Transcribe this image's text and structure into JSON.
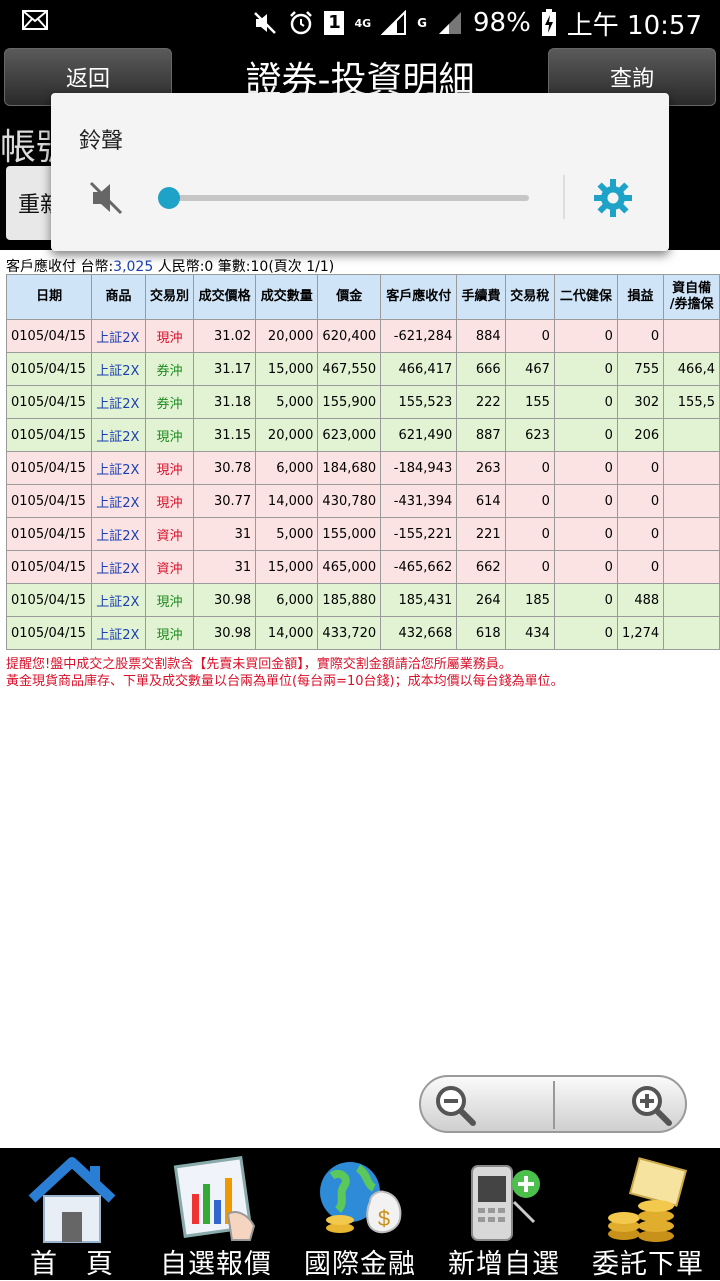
{
  "status_bar": {
    "battery": "98%",
    "time": "上午 10:57",
    "sim": "1",
    "network_4g": "4G",
    "network_g": "G"
  },
  "header": {
    "back_label": "返回",
    "title": "證券-投資明細",
    "query_label": "查詢"
  },
  "subarea": {
    "account_label": "帳號",
    "refresh_label": "重新"
  },
  "volume_popup": {
    "title": "鈴聲",
    "level": 0
  },
  "summary": {
    "prefix": "客戶應收付 台幣:",
    "twd_value": "3,025",
    "rest": " 人民幣:0 筆數:10(頁次 1/1)"
  },
  "table": {
    "headers": [
      "日期",
      "商品",
      "交易別",
      "成交價格",
      "成交數量",
      "價金",
      "客戶應收付",
      "手續費",
      "交易稅",
      "二代健保",
      "損益",
      "資自備\n/券擔保"
    ],
    "rows": [
      {
        "style": "pink",
        "cells": [
          "0105/04/15",
          "上証2X",
          "現沖",
          "31.02",
          "20,000",
          "620,400",
          "-621,284",
          "884",
          "0",
          "0",
          "0",
          ""
        ],
        "type_color": "red"
      },
      {
        "style": "green",
        "cells": [
          "0105/04/15",
          "上証2X",
          "券沖",
          "31.17",
          "15,000",
          "467,550",
          "466,417",
          "666",
          "467",
          "0",
          "755",
          "466,4"
        ],
        "type_color": "green"
      },
      {
        "style": "green",
        "cells": [
          "0105/04/15",
          "上証2X",
          "券沖",
          "31.18",
          "5,000",
          "155,900",
          "155,523",
          "222",
          "155",
          "0",
          "302",
          "155,5"
        ],
        "type_color": "green"
      },
      {
        "style": "green",
        "cells": [
          "0105/04/15",
          "上証2X",
          "現沖",
          "31.15",
          "20,000",
          "623,000",
          "621,490",
          "887",
          "623",
          "0",
          "206",
          ""
        ],
        "type_color": "green"
      },
      {
        "style": "pink",
        "cells": [
          "0105/04/15",
          "上証2X",
          "現沖",
          "30.78",
          "6,000",
          "184,680",
          "-184,943",
          "263",
          "0",
          "0",
          "0",
          ""
        ],
        "type_color": "red"
      },
      {
        "style": "pink",
        "cells": [
          "0105/04/15",
          "上証2X",
          "現沖",
          "30.77",
          "14,000",
          "430,780",
          "-431,394",
          "614",
          "0",
          "0",
          "0",
          ""
        ],
        "type_color": "red"
      },
      {
        "style": "pink",
        "cells": [
          "0105/04/15",
          "上証2X",
          "資沖",
          "31",
          "5,000",
          "155,000",
          "-155,221",
          "221",
          "0",
          "0",
          "0",
          ""
        ],
        "type_color": "red"
      },
      {
        "style": "pink",
        "cells": [
          "0105/04/15",
          "上証2X",
          "資沖",
          "31",
          "15,000",
          "465,000",
          "-465,662",
          "662",
          "0",
          "0",
          "0",
          ""
        ],
        "type_color": "red"
      },
      {
        "style": "green",
        "cells": [
          "0105/04/15",
          "上証2X",
          "現沖",
          "30.98",
          "6,000",
          "185,880",
          "185,431",
          "264",
          "185",
          "0",
          "488",
          ""
        ],
        "type_color": "green"
      },
      {
        "style": "green",
        "cells": [
          "0105/04/15",
          "上証2X",
          "現沖",
          "30.98",
          "14,000",
          "433,720",
          "432,668",
          "618",
          "434",
          "0",
          "1,274",
          ""
        ],
        "type_color": "green"
      }
    ]
  },
  "notes": [
    "提醒您!盤中成交之股票交割款含【先賣未買回金額】，實際交割金額請洽您所屬業務員。",
    "黃金現貨商品庫存、下單及成交數量以台兩為單位(每台兩=10台錢)；成本均價以每台錢為單位。"
  ],
  "bottom_nav": [
    {
      "label": "首　頁",
      "icon": "home-icon"
    },
    {
      "label": "自選報價",
      "icon": "quote-chart-icon"
    },
    {
      "label": "國際金融",
      "icon": "globe-money-icon"
    },
    {
      "label": "新增自選",
      "icon": "add-phone-icon"
    },
    {
      "label": "委託下單",
      "icon": "gold-coins-icon"
    }
  ],
  "colors": {
    "header_bg": "#000000",
    "table_header": "#cfe4f7",
    "row_pink": "#fbe3e3",
    "row_green": "#e2f3d4",
    "accent_blue": "#1fa2c8",
    "note_red": "#d8102a"
  }
}
